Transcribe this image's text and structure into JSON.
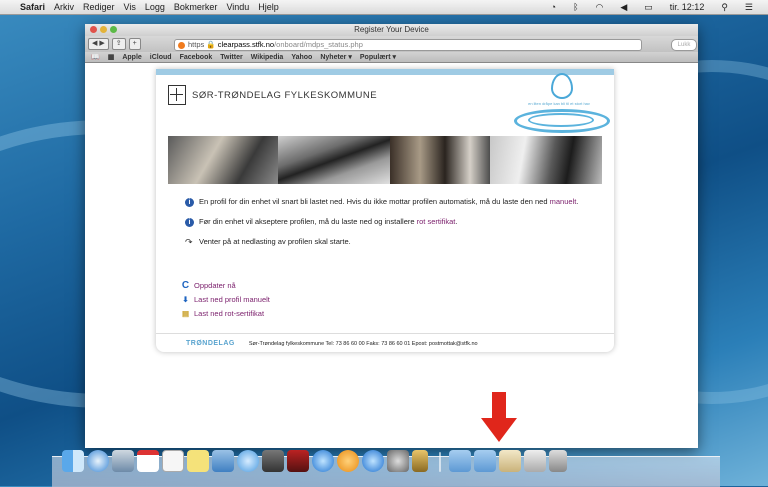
{
  "menubar": {
    "app": "Safari",
    "items": [
      "Arkiv",
      "Rediger",
      "Vis",
      "Logg",
      "Bokmerker",
      "Vindu",
      "Hjelp"
    ],
    "clock": "tir. 12:12"
  },
  "window": {
    "title": "Register Your Device",
    "url_https": "https",
    "url_host": "clearpass.stfk.no",
    "url_path": "/onboard/mdps_status.php",
    "search_placeholder": "Lukk"
  },
  "bookmarks": [
    "Apple",
    "iCloud",
    "Facebook",
    "Twitter",
    "Wikipedia",
    "Yahoo",
    "Nyheter ▾",
    "Populært ▾"
  ],
  "page": {
    "org_name": "SØR-TRØNDELAG FYLKESKOMMUNE",
    "tagline": "en liten dråpe kan bli til et stort hav",
    "messages": {
      "m1_text": "En profil for din enhet vil snart bli lastet ned. Hvis du ikke mottar profilen automatisk, må du laste den ned ",
      "m1_link": "manuelt",
      "m1_end": ".",
      "m2_text": "Før din enhet vil akseptere profilen, må du laste ned og installere ",
      "m2_link": "rot sertifikat",
      "m2_end": ".",
      "m3_text": "Venter på at nedlasting av profilen skal starte."
    },
    "actions": {
      "refresh": "Oppdater nå",
      "download_profile": "Last ned profil manuelt",
      "download_cert": "Last ned rot-sertifikat"
    },
    "footer": {
      "logo": "TRØNDELAG",
      "text": "Sør-Trøndelag fylkeskommune   Tel: 73 86 60 00   Faks: 73 86 60 01   Epost: postmottak@stfk.no"
    }
  },
  "colors": {
    "link": "#7a1e6b",
    "info": "#2a5ba8",
    "accent_blue": "#5bb3dd",
    "arrow_red": "#e0261b"
  }
}
